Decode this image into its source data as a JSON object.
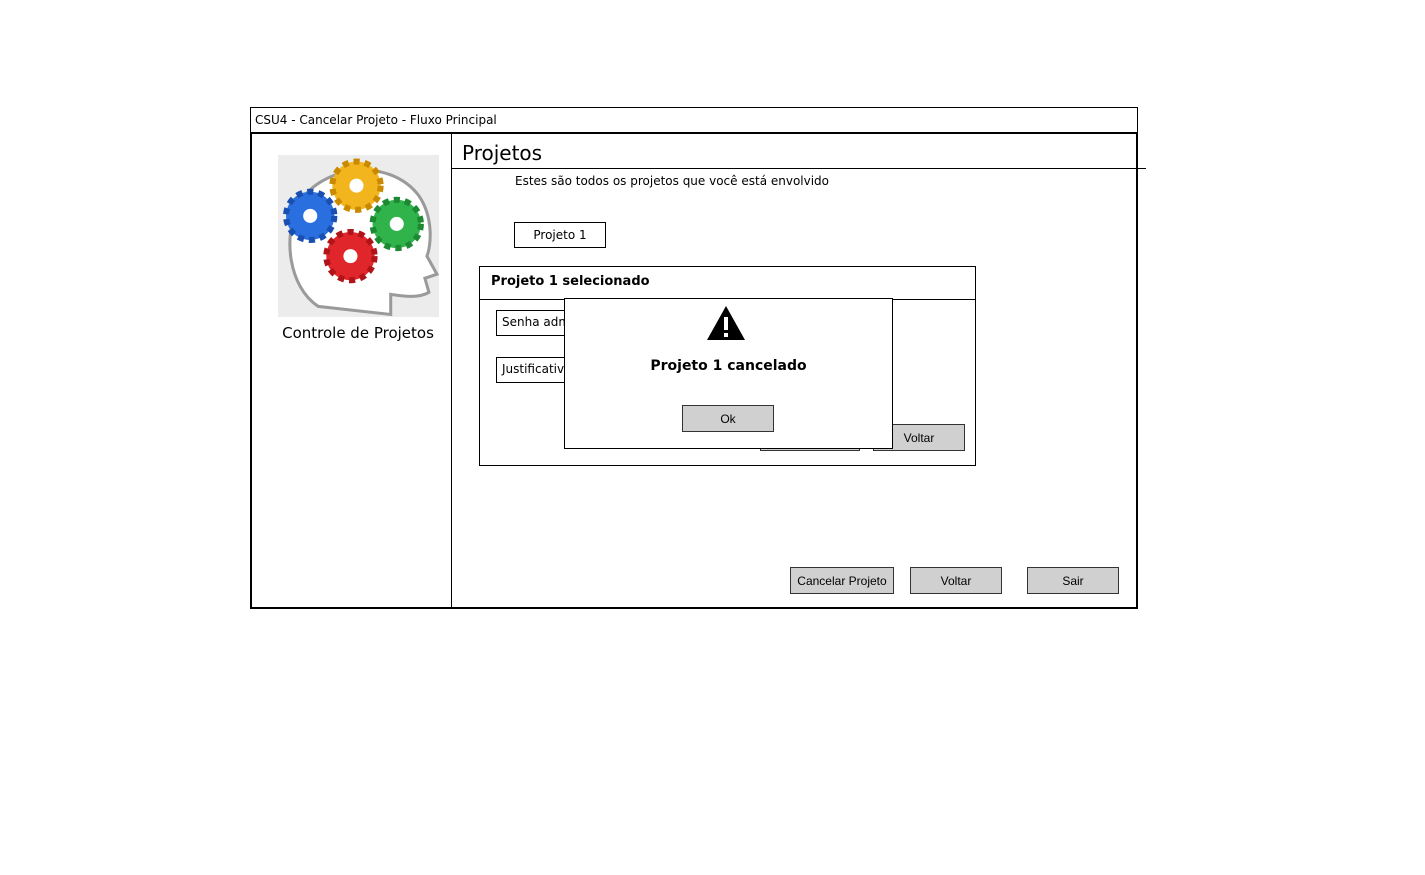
{
  "window": {
    "title": "CSU4 - Cancelar Projeto - Fluxo Principal"
  },
  "sidebar": {
    "app_name": "Controle de Projetos",
    "logo_icon": "head-gears-icon"
  },
  "main": {
    "title": "Projetos",
    "subtitle": "Estes são todos os projetos que você está envolvido",
    "project_button": "Projeto 1"
  },
  "dialog": {
    "title": "Projeto 1 selecionado",
    "senha_field": "Senha administrador",
    "justificativa_field": "Justificativa",
    "voltar_button": "Voltar"
  },
  "alert": {
    "icon": "warning-icon",
    "message": "Projeto 1 cancelado",
    "ok_button": "Ok"
  },
  "footer": {
    "cancel_button": "Cancelar Projeto",
    "voltar_button": "Voltar",
    "sair_button": "Sair"
  },
  "colors": {
    "button_fill": "#d0d0d0",
    "border": "#000000"
  }
}
